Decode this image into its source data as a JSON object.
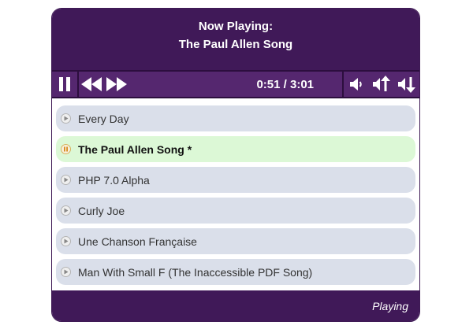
{
  "header": {
    "line1": "Now Playing:",
    "line2": "The Paul Allen Song"
  },
  "controls": {
    "time": "0:51 / 3:01",
    "icons": [
      "pause-icon",
      "rewind-icon",
      "fast-forward-icon",
      "volume-icon",
      "volume-up-icon",
      "volume-down-icon"
    ]
  },
  "playlist": [
    {
      "label": "Every Day",
      "state": "play"
    },
    {
      "label": "The Paul Allen Song *",
      "state": "pause"
    },
    {
      "label": "PHP 7.0 Alpha",
      "state": "play"
    },
    {
      "label": "Curly Joe",
      "state": "play"
    },
    {
      "label": "Une Chanson Française",
      "state": "play"
    },
    {
      "label": "Man With Small F (The Inaccessible PDF Song)",
      "state": "play"
    }
  ],
  "colors": {
    "header_bg": "#401958",
    "bar_bg": "#55276f",
    "item_bg": "#dadfea",
    "active_item_bg": "#dcf8d6"
  },
  "status": "Playing"
}
